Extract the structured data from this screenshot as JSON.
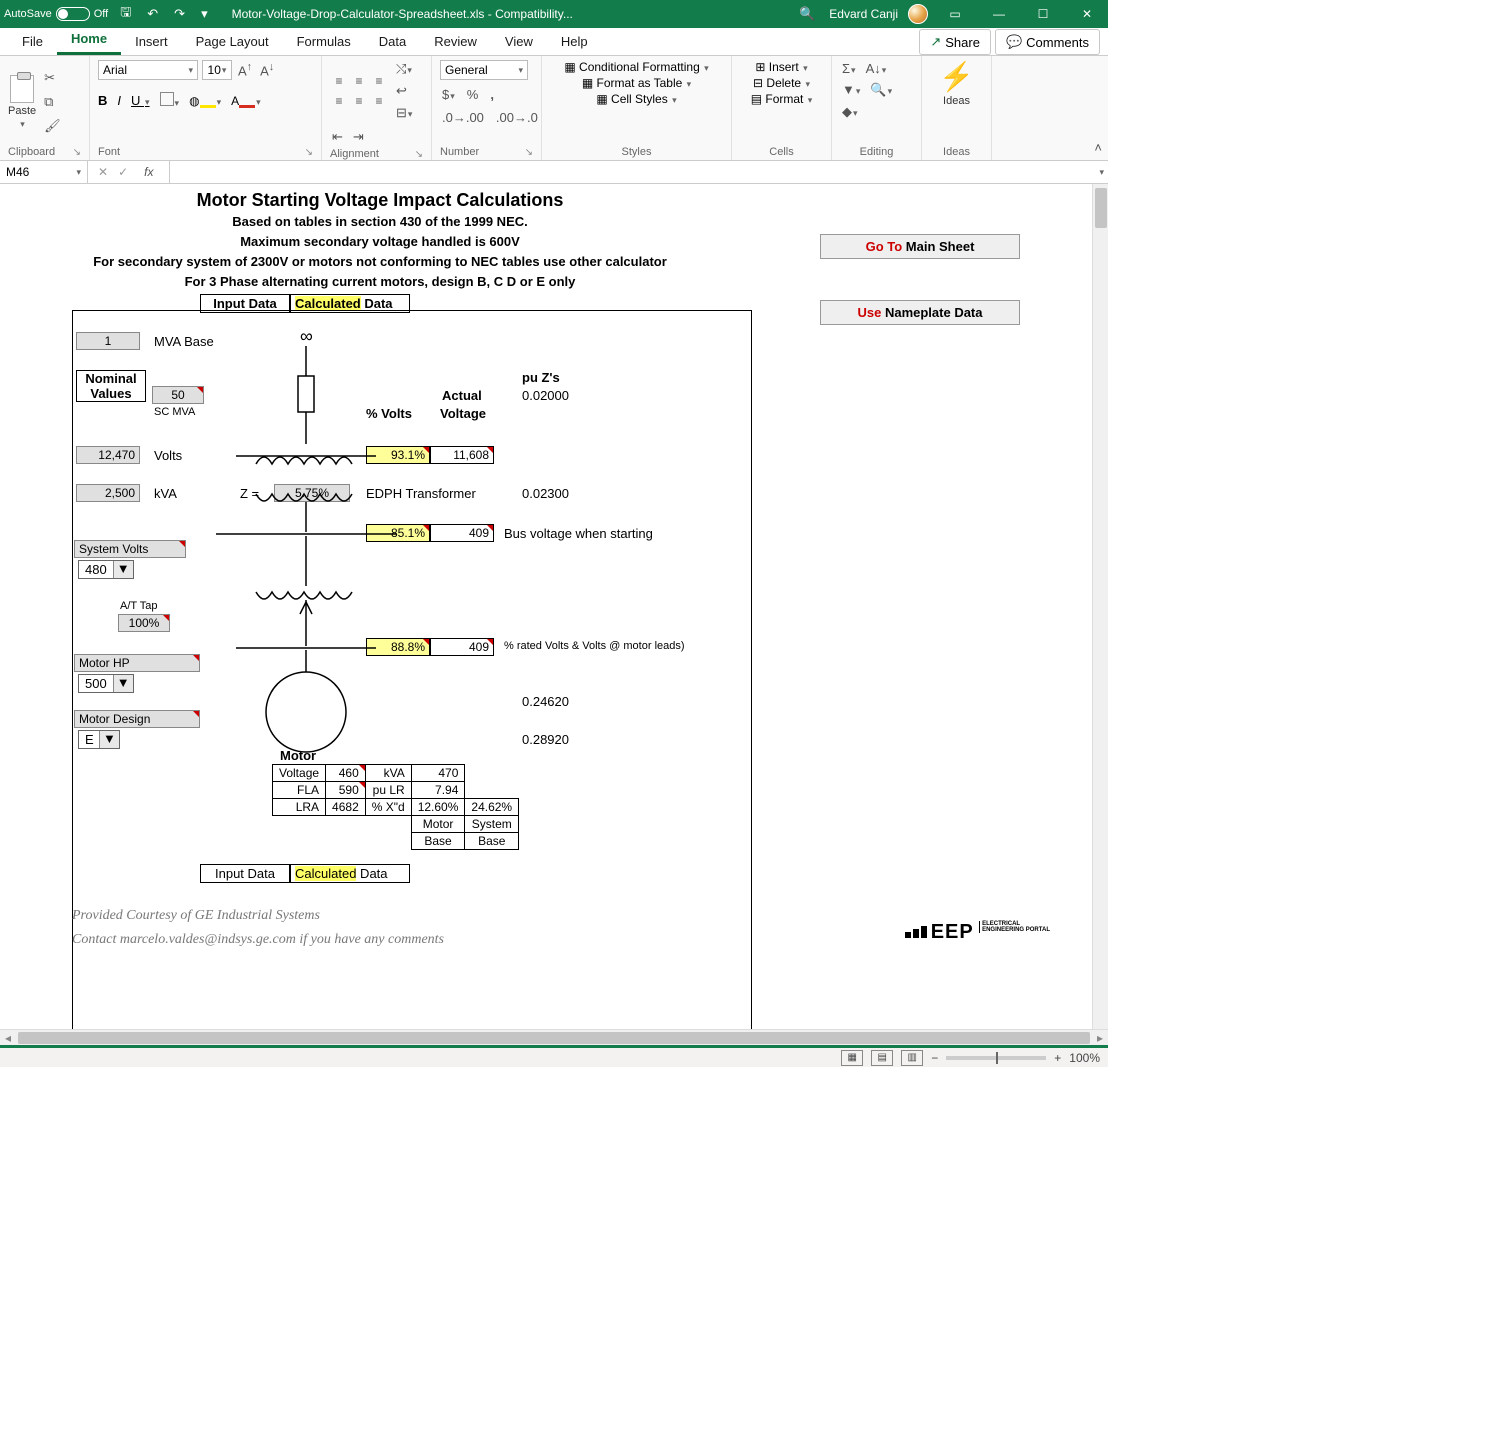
{
  "titlebar": {
    "autosave_label": "AutoSave",
    "autosave_state": "Off",
    "doc_name": "Motor-Voltage-Drop-Calculator-Spreadsheet.xls",
    "mode": "Compatibility...",
    "user": "Edvard Canji"
  },
  "tabs": {
    "file": "File",
    "home": "Home",
    "insert": "Insert",
    "page_layout": "Page Layout",
    "formulas": "Formulas",
    "data": "Data",
    "review": "Review",
    "view": "View",
    "help": "Help",
    "share": "Share",
    "comments": "Comments"
  },
  "ribbon": {
    "clipboard": {
      "paste": "Paste",
      "group": "Clipboard"
    },
    "font": {
      "name": "Arial",
      "size": "10",
      "group": "Font"
    },
    "alignment": {
      "group": "Alignment"
    },
    "number": {
      "format": "General",
      "group": "Number"
    },
    "styles": {
      "cond": "Conditional Formatting",
      "table": "Format as Table",
      "cell": "Cell Styles",
      "group": "Styles"
    },
    "cells": {
      "insert": "Insert",
      "delete": "Delete",
      "format": "Format",
      "group": "Cells"
    },
    "editing": {
      "group": "Editing"
    },
    "ideas": {
      "label": "Ideas",
      "group": "Ideas"
    }
  },
  "formula_bar": {
    "cell_ref": "M46",
    "fx": "fx"
  },
  "buttons": {
    "goto_pre": "Go To ",
    "goto_suf": "Main Sheet",
    "use_pre": "Use ",
    "use_suf": "Nameplate Data"
  },
  "headings": {
    "title": "Motor Starting Voltage Impact Calculations",
    "sub1": "Based on tables in section 430 of the 1999 NEC.",
    "sub2": "Maximum secondary voltage handled is 600V",
    "sub3": "For secondary system of 2300V or motors not conforming to NEC tables use other calculator",
    "sub4": "For 3 Phase alternating current motors, design B, C D or E only",
    "legend_input": "Input Data",
    "legend_calc_pre": "Calculated",
    "legend_calc_suf": " Data"
  },
  "inputs": {
    "mva_base_val": "1",
    "mva_base_lbl": "MVA Base",
    "nominal_hdr1": "Nominal",
    "nominal_hdr2": "Values",
    "sc_mva_val": "50",
    "sc_mva_lbl": "SC MVA",
    "volts_val": "12,470",
    "volts_lbl": "Volts",
    "kva_val": "2,500",
    "kva_lbl": "kVA",
    "z_eq": "Z  =",
    "z_val": "5.75%",
    "xfmr_lbl": "EDPH Transformer",
    "sysv_lbl": "System Volts",
    "sysv_val": "480",
    "attap_lbl": "A/T Tap",
    "attap_val": "100%",
    "hp_lbl": "Motor HP",
    "hp_val": "500",
    "design_lbl": "Motor  Design",
    "design_val": "E"
  },
  "calc": {
    "pu_hdr": "pu Z's",
    "pu1": "0.02000",
    "pv_hdr": "% Volts",
    "av_hdr1": "Actual",
    "av_hdr2": "Voltage",
    "pct1": "93.1%",
    "v1": "11,608",
    "xfmr_pu": "0.02300",
    "pct2": "85.1%",
    "v2": "409",
    "bus_note": "Bus voltage when starting",
    "pct3": "88.8%",
    "v3": "409",
    "leads_note": "% rated Volts & Volts @ motor leads)",
    "val1": "0.24620",
    "val2": "0.28920",
    "motor_hdr": "Motor",
    "m_voltage_l": "Voltage",
    "m_voltage_v": "460",
    "m_kva_l": "kVA",
    "m_kva_v": "470",
    "m_fla_l": "FLA",
    "m_fla_v": "590",
    "m_pulr_l": "pu LR",
    "m_pulr_v": "7.94",
    "m_lra_l": "LRA",
    "m_lra_v": "4682",
    "m_xd_l": "% X\"d",
    "m_xd_v": "12.60%",
    "m_xd_v2": "24.62%",
    "m_base1": "Motor",
    "m_base1b": "Base",
    "m_base2": "System",
    "m_base2b": "Base"
  },
  "footer": {
    "l1": "Provided Courtesy of GE Industrial Systems",
    "l2": "Contact marcelo.valdes@indsys.ge.com if you have any comments"
  },
  "eep": {
    "brand": "EEP",
    "sub1": "ELECTRICAL",
    "sub2": "ENGINEERING PORTAL"
  },
  "status": {
    "zoom": "100%"
  }
}
